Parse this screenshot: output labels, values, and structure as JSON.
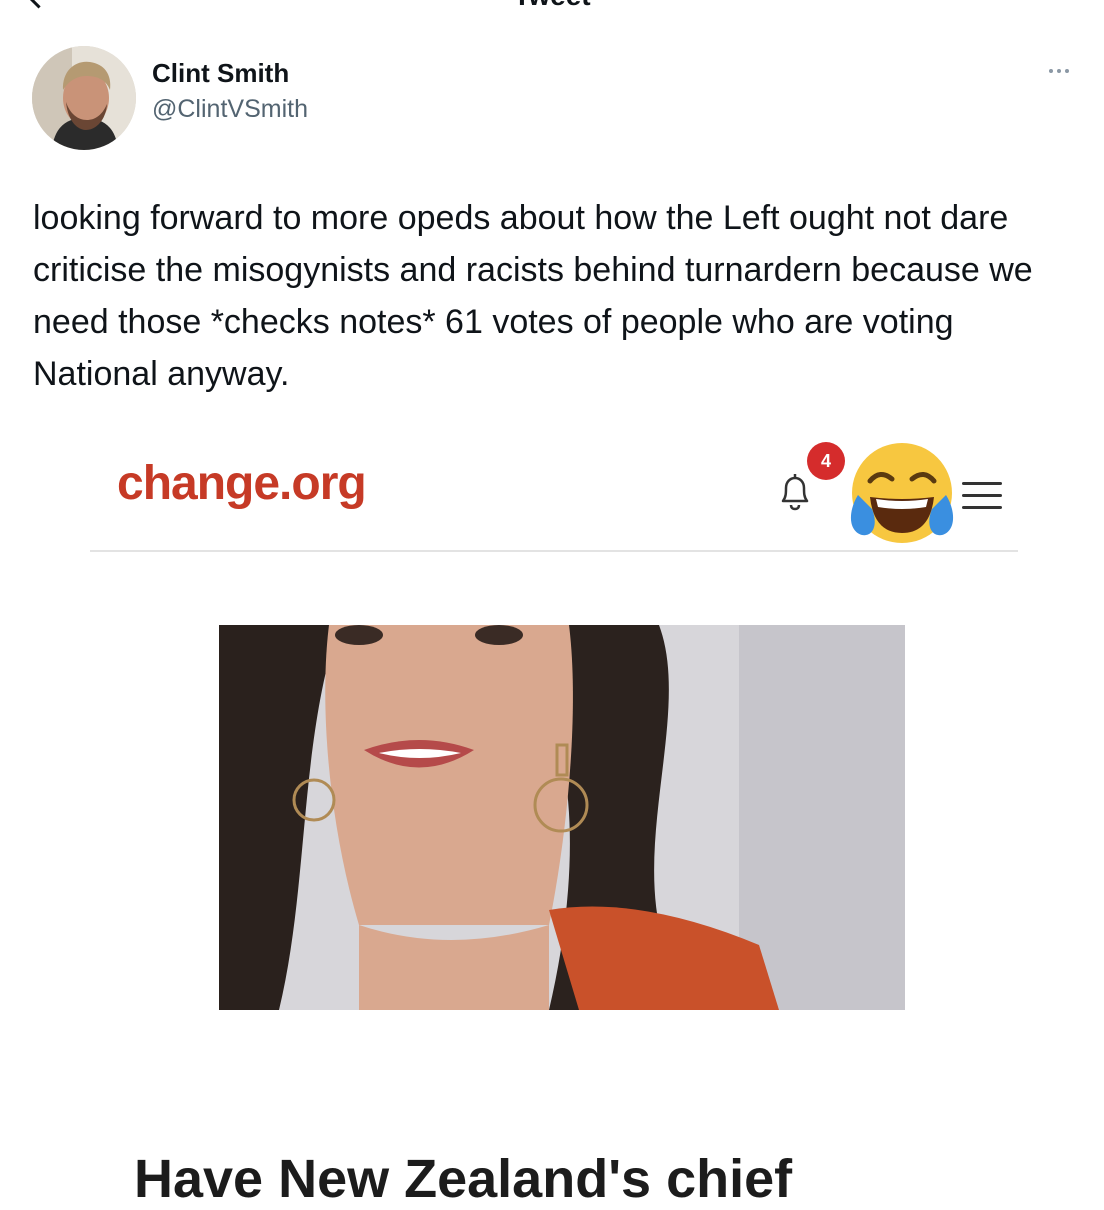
{
  "topbar": {
    "title": "Tweet"
  },
  "author": {
    "name": "Clint Smith",
    "handle": "@ClintVSmith",
    "avatar_icon": "user-avatar-photo",
    "more_icon": "more-dots-icon"
  },
  "tweet": {
    "text": "looking forward to more opeds about how the Left ought not dare criticise the misogynists and racists behind turnardern because we need those *checks notes* 61 votes of people who are voting National anyway."
  },
  "embed": {
    "brand": "change.org",
    "notification_count": "4",
    "emoji": "tears-of-joy-emoji",
    "menu_icon": "hamburger-menu-icon",
    "photo_alt": "portrait-photo",
    "petition_title": "Have New Zealand's chief"
  },
  "colors": {
    "brand_red": "#c63a26",
    "text": "#0f1419",
    "muted": "#536471",
    "badge_red": "#d52c2c"
  }
}
